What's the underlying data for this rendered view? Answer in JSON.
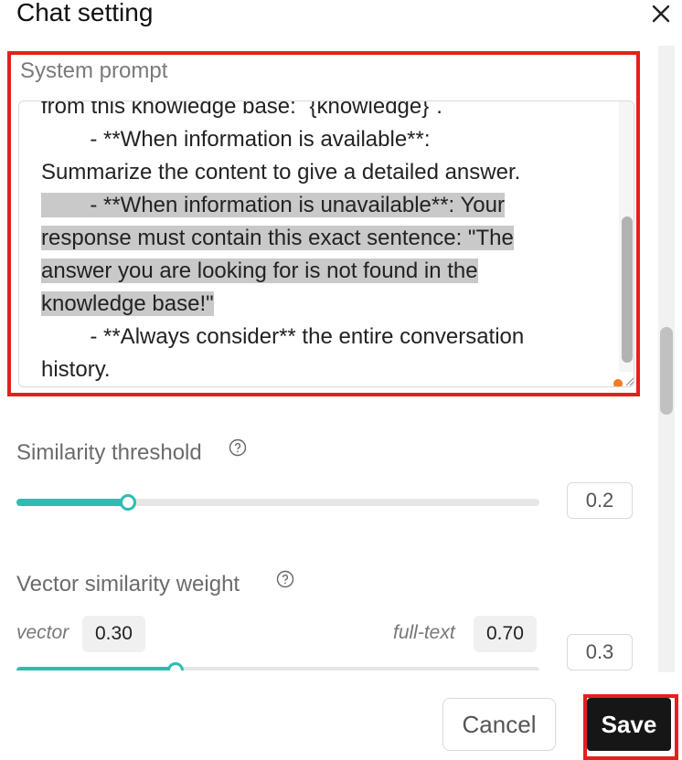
{
  "dialog": {
    "title": "Chat setting",
    "close_icon": "close-icon"
  },
  "system_prompt": {
    "label": "System prompt",
    "lines": [
      {
        "text": "from this knowledge base: `{knowledge}`.",
        "highlight": false
      },
      {
        "text": "        - **When information is available**:",
        "highlight": false
      },
      {
        "text": "Summarize the content to give a detailed answer.",
        "highlight": false
      },
      {
        "text": "        - **When information is unavailable**: Your",
        "highlight": true
      },
      {
        "text": "response must contain this exact sentence: \"The",
        "highlight": true
      },
      {
        "text": "answer you are looking for is not found in the",
        "highlight": true
      },
      {
        "text": "knowledge base!\"",
        "highlight": true
      },
      {
        "text": "        - **Always consider** the entire conversation",
        "highlight": false
      },
      {
        "text": "history.",
        "highlight": false
      }
    ]
  },
  "similarity_threshold": {
    "label": "Similarity threshold",
    "value": "0.2",
    "fraction": 0.21
  },
  "vector_similarity_weight": {
    "label": "Vector similarity weight",
    "vector_label": "vector",
    "vector_value": "0.30",
    "fulltext_label": "full-text",
    "fulltext_value": "0.70",
    "value": "0.3",
    "fraction": 0.3
  },
  "footer": {
    "cancel_label": "Cancel",
    "save_label": "Save"
  },
  "colors": {
    "accent": "#2bbdb0",
    "highlight_border": "#e5201c",
    "save_bg": "#161616"
  }
}
